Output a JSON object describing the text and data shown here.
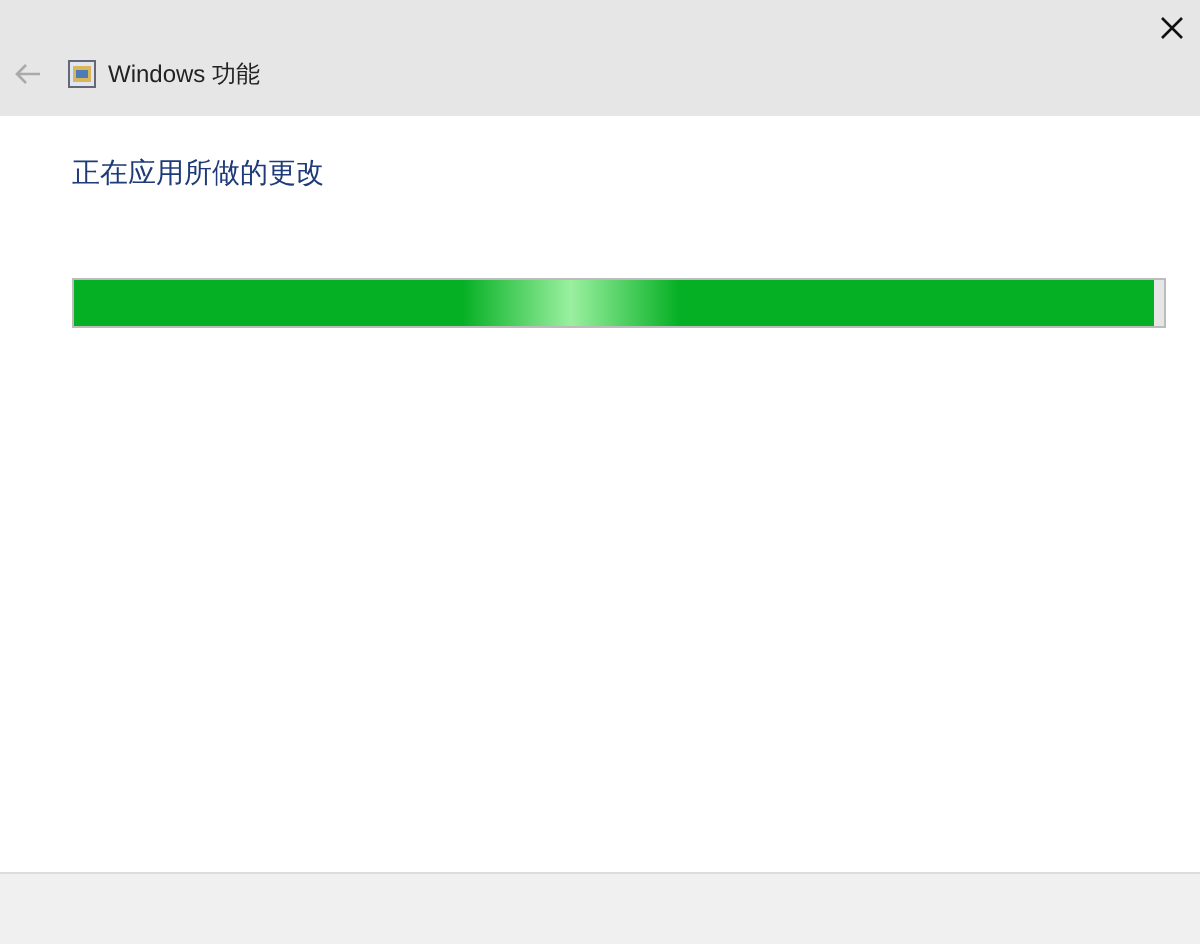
{
  "window": {
    "title": "Windows 功能"
  },
  "heading": "正在应用所做的更改",
  "progress": {
    "level": 0.99
  }
}
